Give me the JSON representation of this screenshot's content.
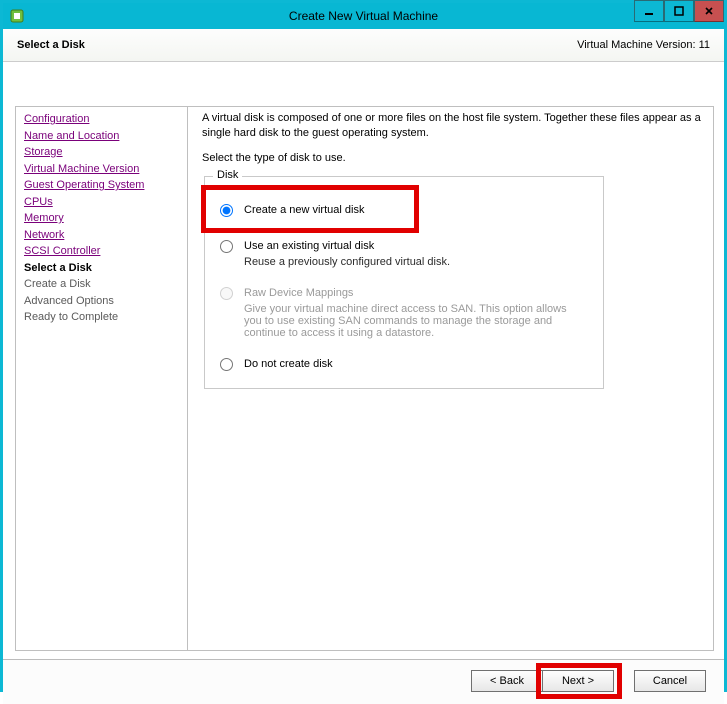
{
  "window": {
    "title": "Create New Virtual Machine"
  },
  "header": {
    "title": "Select a Disk",
    "version": "Virtual Machine Version: 11"
  },
  "sidebar": {
    "steps": [
      {
        "label": "Configuration",
        "state": "done"
      },
      {
        "label": "Name and Location",
        "state": "done"
      },
      {
        "label": "Storage",
        "state": "done"
      },
      {
        "label": "Virtual Machine Version",
        "state": "done"
      },
      {
        "label": "Guest Operating System",
        "state": "done"
      },
      {
        "label": "CPUs",
        "state": "done"
      },
      {
        "label": "Memory",
        "state": "done"
      },
      {
        "label": "Network",
        "state": "done"
      },
      {
        "label": "SCSI Controller",
        "state": "done"
      },
      {
        "label": "Select a Disk",
        "state": "current"
      },
      {
        "label": "Create a Disk",
        "state": "future"
      },
      {
        "label": "Advanced Options",
        "state": "future"
      },
      {
        "label": "Ready to Complete",
        "state": "future"
      }
    ]
  },
  "main": {
    "intro1": "A virtual disk is composed of one or more files on the host file system. Together these files appear as a single hard disk to the guest operating system.",
    "intro2": "Select the type of disk to use.",
    "group_legend": "Disk",
    "opt1": {
      "label": "Create a new virtual disk"
    },
    "opt2": {
      "label": "Use an existing virtual disk",
      "desc": "Reuse a previously configured virtual disk."
    },
    "opt3": {
      "label": "Raw Device Mappings",
      "desc": "Give your virtual machine direct access to SAN. This option allows you to use existing SAN commands to manage the storage and continue to access it using a datastore."
    },
    "opt4": {
      "label": "Do not create disk"
    }
  },
  "footer": {
    "back": "< Back",
    "next": "Next >",
    "cancel": "Cancel"
  }
}
